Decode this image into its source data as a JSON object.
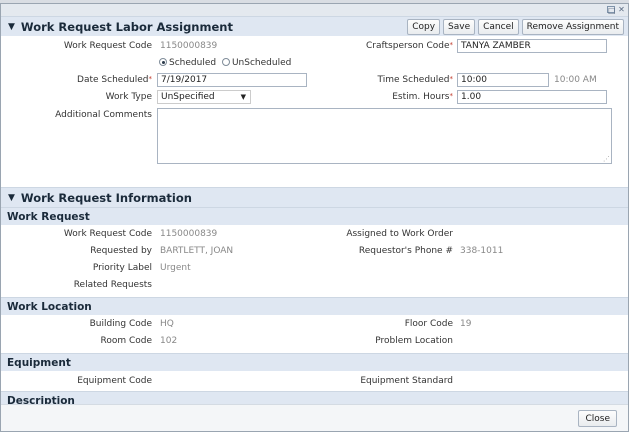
{
  "window": {
    "maximize_glyph": "□",
    "close_glyph": "✕"
  },
  "labor": {
    "title": "Work Request Labor Assignment",
    "buttons": {
      "copy": "Copy",
      "save": "Save",
      "cancel": "Cancel",
      "remove": "Remove Assignment"
    },
    "work_request_code_label": "Work Request Code",
    "work_request_code": "1150000839",
    "craftsperson_label": "Craftsperson Code",
    "craftsperson_value": "TANYA ZAMBER",
    "schedule_options": {
      "scheduled": "Scheduled",
      "unscheduled": "UnScheduled",
      "selected": "Scheduled"
    },
    "date_scheduled_label": "Date Scheduled",
    "date_scheduled": "7/19/2017",
    "time_scheduled_label": "Time Scheduled",
    "time_scheduled": "10:00",
    "time_display": "10:00 AM",
    "work_type_label": "Work Type",
    "work_type": "UnSpecified",
    "estim_hours_label": "Estim. Hours",
    "estim_hours": "1.00",
    "comments_label": "Additional Comments",
    "required_mark": "*"
  },
  "info": {
    "title": "Work Request Information",
    "work_request": {
      "heading": "Work Request",
      "code_label": "Work Request Code",
      "code": "1150000839",
      "assigned_label": "Assigned to Work Order",
      "requested_by_label": "Requested by",
      "requested_by": "BARTLETT, JOAN",
      "phone_label": "Requestor's Phone #",
      "phone": "338-1011",
      "priority_label": "Priority Label",
      "priority": "Urgent",
      "related_label": "Related Requests"
    },
    "location": {
      "heading": "Work Location",
      "building_label": "Building Code",
      "building": "HQ",
      "floor_label": "Floor Code",
      "floor": "19",
      "room_label": "Room Code",
      "room": "102",
      "problem_label": "Problem Location"
    },
    "equipment": {
      "heading": "Equipment",
      "code_label": "Equipment Code",
      "standard_label": "Equipment Standard"
    },
    "description": {
      "heading": "Description"
    }
  },
  "footer": {
    "close": "Close"
  },
  "icons": {
    "caret": "▼",
    "select_caret": "▼",
    "grip": "⋰"
  }
}
